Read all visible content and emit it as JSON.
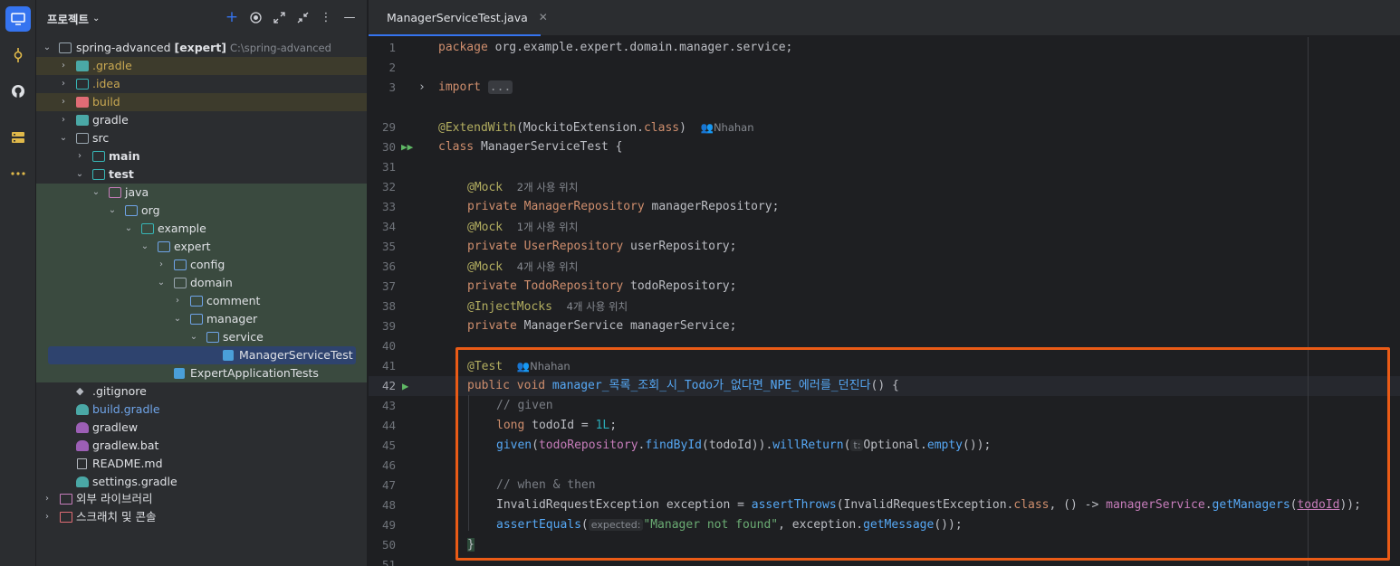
{
  "project_panel": {
    "title": "프로젝트",
    "tree": [
      {
        "label": "spring-advanced",
        "bold_suffix": "[expert]",
        "path": "C:\\spring-advanced",
        "arrow": "down"
      },
      {
        "label": ".gradle",
        "arrow": "right"
      },
      {
        "label": ".idea",
        "arrow": "right"
      },
      {
        "label": "build",
        "arrow": "right"
      },
      {
        "label": "gradle",
        "arrow": "right"
      },
      {
        "label": "src",
        "arrow": "down"
      },
      {
        "label": "main",
        "arrow": "right"
      },
      {
        "label": "test",
        "arrow": "down"
      },
      {
        "label": "java",
        "arrow": "down"
      },
      {
        "label": "org",
        "arrow": "down"
      },
      {
        "label": "example",
        "arrow": "down"
      },
      {
        "label": "expert",
        "arrow": "down"
      },
      {
        "label": "config",
        "arrow": "right"
      },
      {
        "label": "domain",
        "arrow": "down"
      },
      {
        "label": "comment",
        "arrow": "right"
      },
      {
        "label": "manager",
        "arrow": "down"
      },
      {
        "label": "service",
        "arrow": "down"
      },
      {
        "label": "ManagerServiceTest",
        "arrow": ""
      },
      {
        "label": "ExpertApplicationTests",
        "arrow": ""
      },
      {
        "label": ".gitignore",
        "arrow": ""
      },
      {
        "label": "build.gradle",
        "arrow": ""
      },
      {
        "label": "gradlew",
        "arrow": ""
      },
      {
        "label": "gradlew.bat",
        "arrow": ""
      },
      {
        "label": "README.md",
        "arrow": ""
      },
      {
        "label": "settings.gradle",
        "arrow": ""
      },
      {
        "label": "외부 라이브러리",
        "arrow": "right"
      },
      {
        "label": "스크래치 및 콘솔",
        "arrow": "right"
      }
    ]
  },
  "tab": {
    "label": "ManagerServiceTest.java"
  },
  "editor": {
    "line_numbers": [
      "1",
      "2",
      "3",
      "29",
      "30",
      "31",
      "32",
      "33",
      "34",
      "35",
      "36",
      "37",
      "38",
      "39",
      "40",
      "41",
      "42",
      "43",
      "44",
      "45",
      "46",
      "47",
      "48",
      "49",
      "50",
      "51"
    ],
    "current_line": "42",
    "author": "Nhahan",
    "usages_2": "2개 사용 위치",
    "usages_1": "1개 사용 위치",
    "usages_4a": "4개 사용 위치",
    "usages_4b": "4개 사용 위치",
    "line1": {
      "kw": "package",
      "rest": " org.example.expert.domain.manager.service;"
    },
    "line3": {
      "kw": "import",
      "fold": "..."
    },
    "line29": {
      "ann": "@ExtendWith",
      "open": "(",
      "cls": "MockitoExtension",
      "dot": ".",
      "kw": "class",
      "close": ")"
    },
    "line30": {
      "kw": "class",
      "rest": " ManagerServiceTest {"
    },
    "line32": {
      "ann": "@Mock"
    },
    "line33": {
      "kw": "private",
      "type": "ManagerRepository",
      "field": "managerRepository",
      "semi": ";"
    },
    "line34": {
      "ann": "@Mock"
    },
    "line35": {
      "kw": "private",
      "type": "UserRepository",
      "field": "userRepository",
      "semi": ";"
    },
    "line36": {
      "ann": "@Mock"
    },
    "line37": {
      "kw": "private",
      "type": "TodoRepository",
      "field": "todoRepository",
      "semi": ";"
    },
    "line38": {
      "ann": "@InjectMocks"
    },
    "line39": {
      "kw": "private",
      "type": "ManagerService",
      "field": "managerService",
      "semi": ";"
    },
    "line41": {
      "ann": "@Test"
    },
    "line42": {
      "kw": "public void",
      "fn": "manager_목록_조회_시_Todo가_없다면_NPE_에러를_던진다",
      "rest": "() {"
    },
    "line43": {
      "cmt": "// given"
    },
    "line44": {
      "kw": "long",
      "var": "todoId",
      "eq": " = ",
      "num": "1L",
      "semi": ";"
    },
    "line45": {
      "fn": "given",
      "p1": "(",
      "fld": "todoRepository",
      "dot": ".",
      "fn2": "findById",
      "p2": "(todoId))",
      "dot2": ".",
      "fn3": "willReturn",
      "p3": "(",
      "hint": "t:",
      "rest": "Optional.",
      "fn4": "empty",
      "end": "());"
    },
    "line47": {
      "cmt": "// when & then"
    },
    "line48": {
      "cls": "InvalidRequestException",
      "var": "exception",
      "eq": " = ",
      "fn": "assertThrows",
      "p1": "(InvalidRequestException.",
      "kw": "class",
      "p2": ", () -> ",
      "fld": "managerService",
      "dot": ".",
      "fn2": "getManagers",
      "p3": "(",
      "arg": "todoId",
      "end": "));"
    },
    "line49": {
      "fn": "assertEquals",
      "p1": "(",
      "hint": "expected:",
      "str": "\"Manager not found\"",
      "p2": ", ",
      "var": "exception",
      "dot": ".",
      "fn2": "getMessage",
      "end": "());"
    },
    "line50": {
      "rest": "}"
    }
  }
}
